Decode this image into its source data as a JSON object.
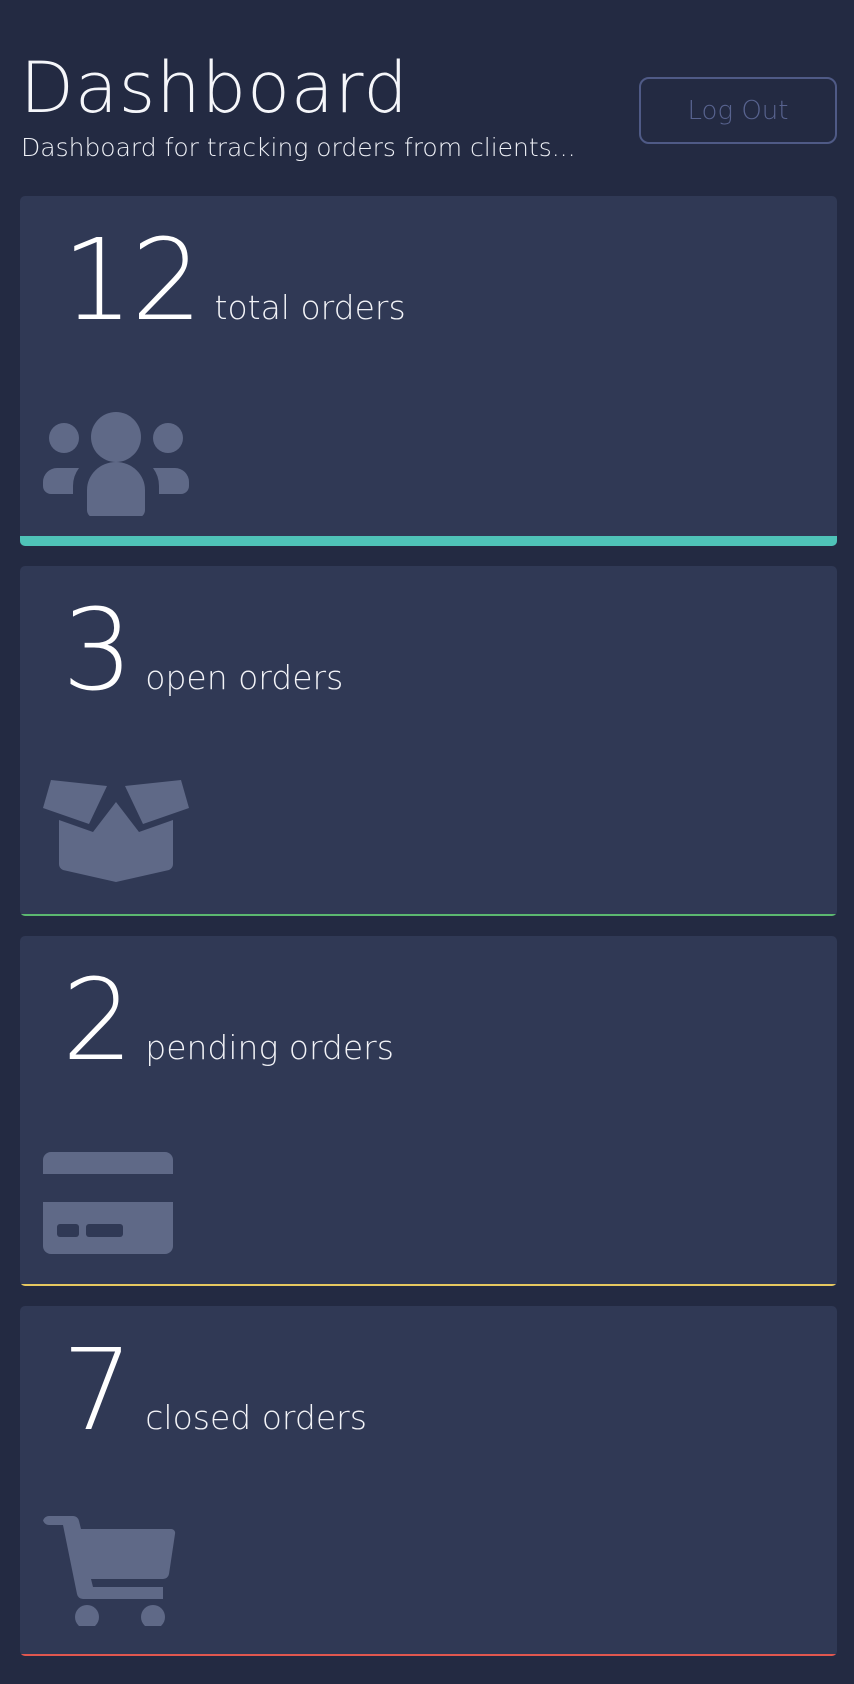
{
  "header": {
    "title": "Dashboard",
    "subtitle": "Dashboard for tracking orders from clients...",
    "logout_label": "Log Out"
  },
  "cards": [
    {
      "value": "12",
      "label": "total orders",
      "icon": "users-icon",
      "accent": "#4fc3b8"
    },
    {
      "value": "3",
      "label": "open orders",
      "icon": "open-box-icon",
      "accent": "#5cb870"
    },
    {
      "value": "2",
      "label": "pending orders",
      "icon": "credit-card-icon",
      "accent": "#e6c860"
    },
    {
      "value": "7",
      "label": "closed orders",
      "icon": "cart-icon",
      "accent": "#e0574f"
    }
  ],
  "colors": {
    "background": "#232a42",
    "card": "#303955",
    "icon": "#5f6987",
    "button_border": "#4f5a86"
  }
}
